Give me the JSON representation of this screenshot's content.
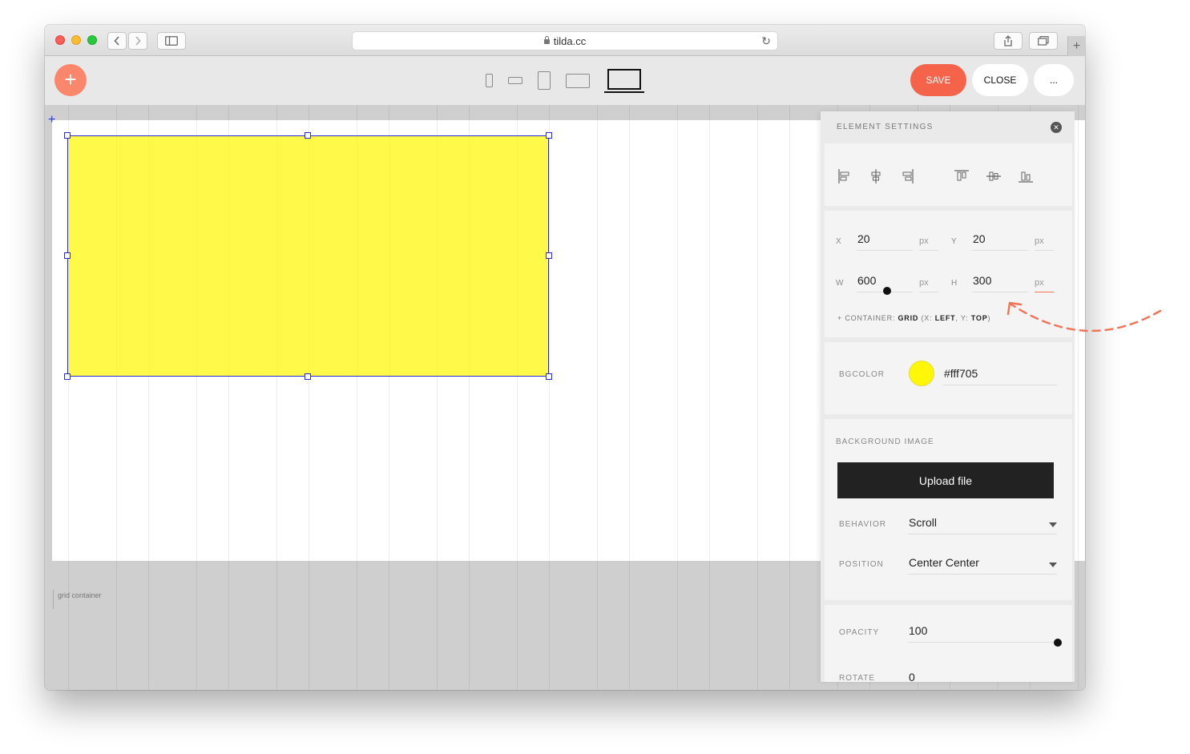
{
  "browser": {
    "url": "tilda.cc",
    "reload_icon": "reload-icon"
  },
  "toolbar": {
    "add_label": "+",
    "save_label": "SAVE",
    "close_label": "CLOSE",
    "more_label": "...",
    "devices": [
      "phone-portrait-icon",
      "phone-landscape-icon",
      "tablet-portrait-icon",
      "tablet-landscape-icon",
      "laptop-icon"
    ],
    "active_device": "laptop-icon"
  },
  "canvas": {
    "grid_label": "grid container",
    "element_color": "#fff705"
  },
  "panel": {
    "title": "ELEMENT SETTINGS",
    "position": {
      "x_label": "X",
      "x_value": "20",
      "x_unit": "px",
      "y_label": "Y",
      "y_value": "20",
      "y_unit": "px",
      "w_label": "W",
      "w_value": "600",
      "w_unit": "px",
      "h_label": "H",
      "h_value": "300",
      "h_unit": "px"
    },
    "container_note": {
      "prefix": "+ CONTAINER: ",
      "grid": "GRID",
      "open": " (X: ",
      "x": "LEFT",
      "mid": ", Y: ",
      "y": "TOP",
      "close": ")"
    },
    "bgcolor": {
      "label": "BGCOLOR",
      "value": "#fff705"
    },
    "background_image": {
      "title": "BACKGROUND IMAGE",
      "upload_label": "Upload file",
      "behavior_label": "BEHAVIOR",
      "behavior_value": "Scroll",
      "position_label": "POSITION",
      "position_value": "Center Center"
    },
    "opacity": {
      "label": "OPACITY",
      "value": "100"
    },
    "rotate": {
      "label": "ROTATE",
      "value": "0"
    }
  },
  "colors": {
    "accent": "#f5634a",
    "add_button": "#fa876b",
    "selection": "#2b2bd0",
    "arrow": "#f0765a"
  }
}
